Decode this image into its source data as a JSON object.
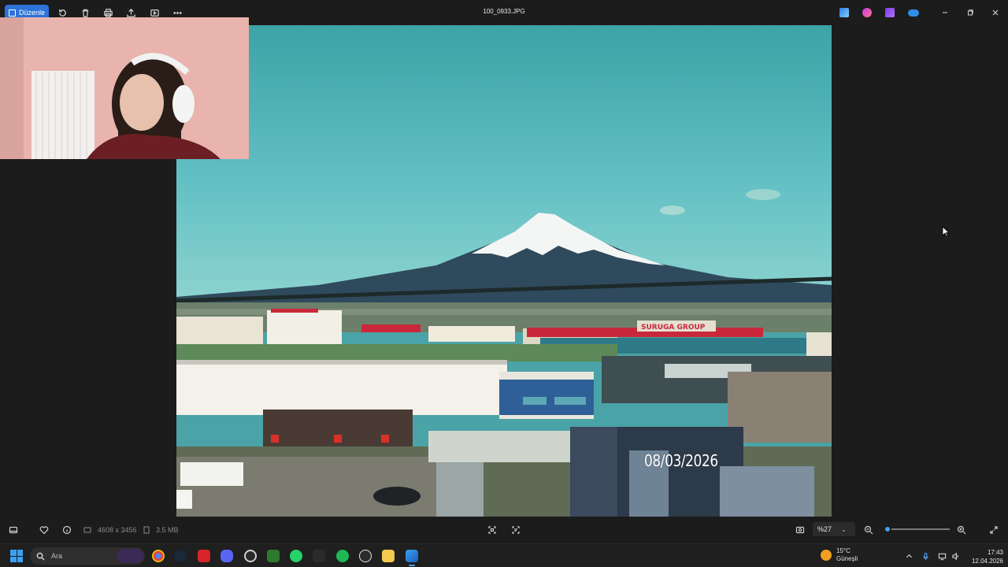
{
  "toolbar": {
    "edit_label": "Düzenle",
    "filename": "100_0933.JPG"
  },
  "photo": {
    "date_stamp": "08/03/2026",
    "sign_text": "SURUGA GROUP"
  },
  "status_bar": {
    "dimensions": "4608 x 3456",
    "file_size": "3.5 MB",
    "zoom_value": "%27",
    "zoom_level": 0.06
  },
  "taskbar": {
    "search_placeholder": "Ara",
    "weather_temp": "15°C",
    "weather_desc": "Güneşli",
    "time": "17:43",
    "date": "12.04.2026"
  },
  "colors": {
    "accent": "#2d73d8",
    "background": "#1c1c1c",
    "zoom_accent": "#4d9ee8"
  }
}
